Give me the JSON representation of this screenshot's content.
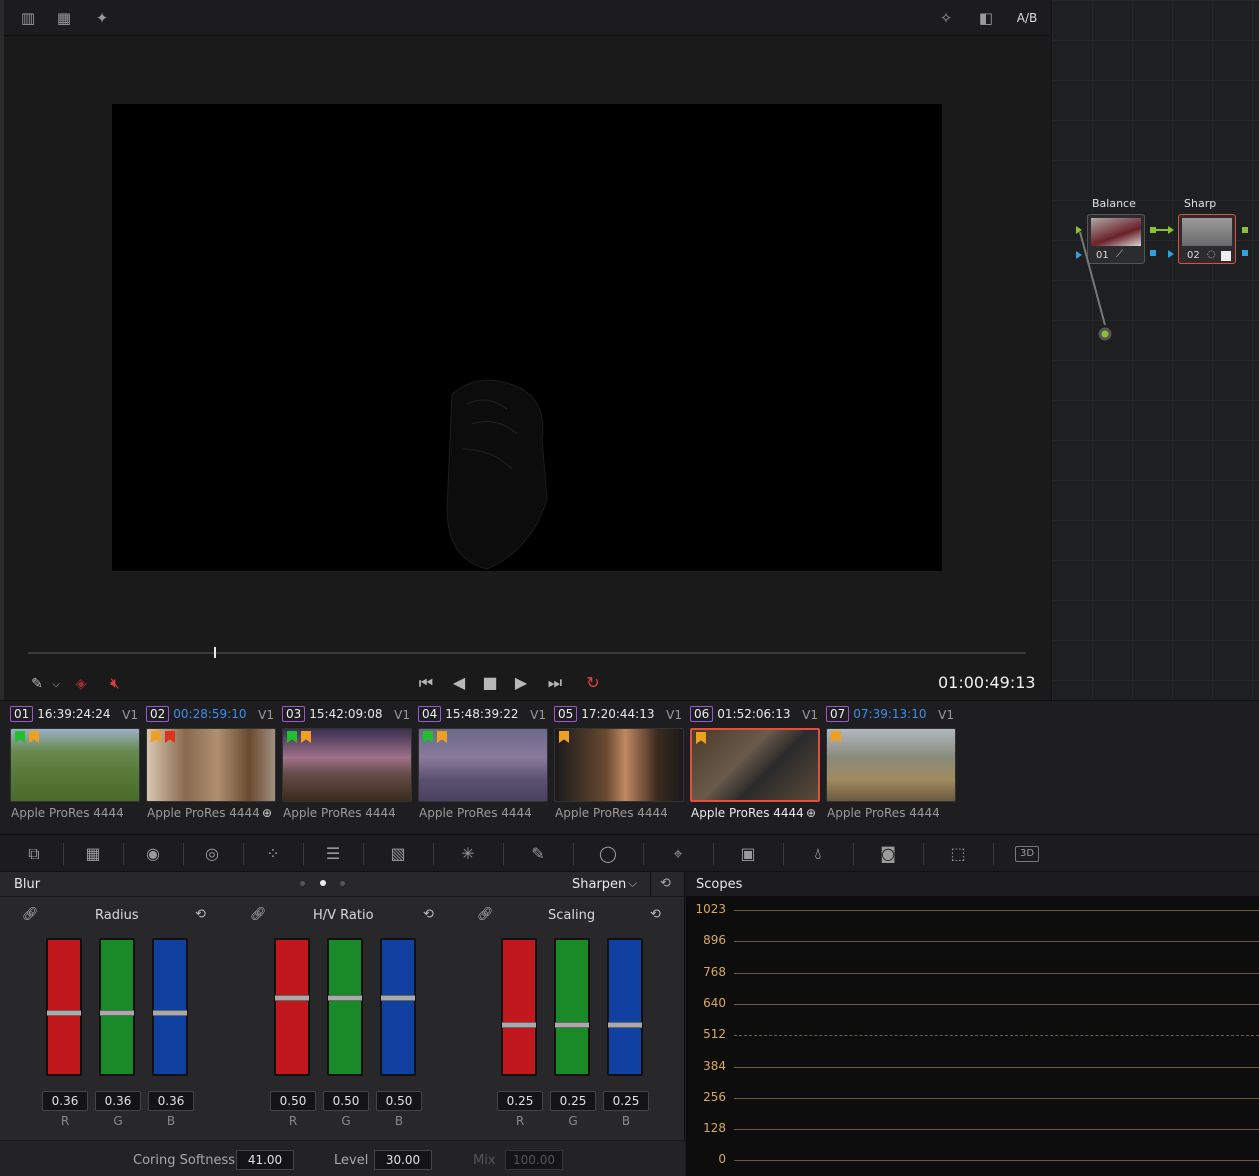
{
  "viewer": {
    "toolbar_right_label": "A/B",
    "timecode": "01:00:49:13"
  },
  "nodes": {
    "node1": {
      "label": "Balance",
      "number": "01"
    },
    "node2": {
      "label": "Sharp",
      "number": "02"
    }
  },
  "clips": [
    {
      "num": "01",
      "timecode": "16:39:24:24",
      "track": "V1",
      "codec": "Apple ProRes 4444"
    },
    {
      "num": "02",
      "timecode": "00:28:59:10",
      "track": "V1",
      "codec": "Apple ProRes 4444"
    },
    {
      "num": "03",
      "timecode": "15:42:09:08",
      "track": "V1",
      "codec": "Apple ProRes 4444"
    },
    {
      "num": "04",
      "timecode": "15:48:39:22",
      "track": "V1",
      "codec": "Apple ProRes 4444"
    },
    {
      "num": "05",
      "timecode": "17:20:44:13",
      "track": "V1",
      "codec": "Apple ProRes 4444"
    },
    {
      "num": "06",
      "timecode": "01:52:06:13",
      "track": "V1",
      "codec": "Apple ProRes 4444"
    },
    {
      "num": "07",
      "timecode": "07:39:13:10",
      "track": "V1",
      "codec": "Apple ProRes 4444"
    }
  ],
  "blur_panel": {
    "title": "Blur",
    "mode": "Sharpen",
    "groups": [
      {
        "title": "Radius",
        "values": [
          "0.36",
          "0.36",
          "0.36"
        ],
        "levels": [
          0.36,
          0.36,
          0.36
        ]
      },
      {
        "title": "H/V Ratio",
        "values": [
          "0.50",
          "0.50",
          "0.50"
        ],
        "levels": [
          0.5,
          0.5,
          0.5
        ]
      },
      {
        "title": "Scaling",
        "values": [
          "0.25",
          "0.25",
          "0.25"
        ],
        "levels": [
          0.25,
          0.25,
          0.25
        ]
      }
    ],
    "channels": [
      "R",
      "G",
      "B"
    ],
    "coring_softness_label": "Coring Softness",
    "coring_softness": "41.00",
    "level_label": "Level",
    "level": "30.00",
    "mix_label": "Mix",
    "mix": "100.00"
  },
  "scopes": {
    "title": "Scopes",
    "ticks": [
      "1023",
      "896",
      "768",
      "640",
      "512",
      "384",
      "256",
      "128",
      "0"
    ]
  },
  "colors": {
    "accent_red": "#e05040",
    "timecode_blue": "#3b8ff0",
    "scope_tick": "#d8a860"
  }
}
